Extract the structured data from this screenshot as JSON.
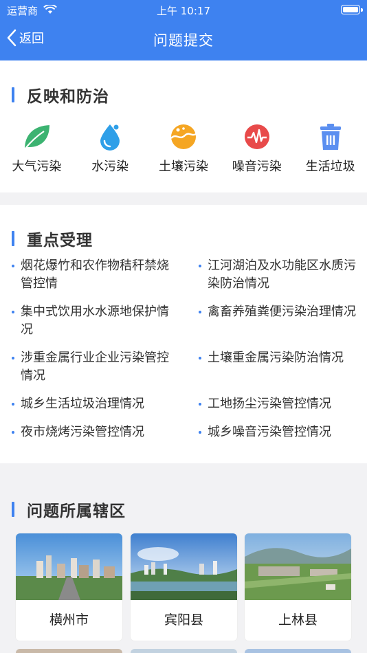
{
  "status_bar": {
    "carrier": "运营商",
    "time": "上午 10:17"
  },
  "nav": {
    "back_label": "返回",
    "title": "问题提交"
  },
  "section_prevention": {
    "title": "反映和防治",
    "items": [
      {
        "label": "大气污染",
        "icon": "leaf-icon",
        "color": "#3cb371"
      },
      {
        "label": "水污染",
        "icon": "water-drop-icon",
        "color": "#2f9fe8"
      },
      {
        "label": "土壤污染",
        "icon": "soil-icon",
        "color": "#f5a623"
      },
      {
        "label": "噪音污染",
        "icon": "sound-wave-icon",
        "color": "#e84a4a"
      },
      {
        "label": "生活垃圾",
        "icon": "trash-icon",
        "color": "#5b8ff0"
      }
    ]
  },
  "section_focus": {
    "title": "重点受理",
    "items": [
      {
        "text": "烟花爆竹和农作物秸秆禁烧管控情"
      },
      {
        "text": "江河湖泊及水功能区水质污染防治情况"
      },
      {
        "text": "集中式饮用水水源地保护情况"
      },
      {
        "text": "禽畜养殖粪便污染治理情况"
      },
      {
        "text": "涉重金属行业企业污染管控情况"
      },
      {
        "text": "土壤重金属污染防治情况"
      },
      {
        "text": "城乡生活垃圾治理情况"
      },
      {
        "text": "工地扬尘污染管控情况"
      },
      {
        "text": "夜市烧烤污染管控情况"
      },
      {
        "text": "城乡噪音污染管控情况"
      }
    ]
  },
  "section_district": {
    "title": "问题所属辖区",
    "items": [
      {
        "name": "横州市"
      },
      {
        "name": "宾阳县"
      },
      {
        "name": "上林县"
      }
    ]
  },
  "colors": {
    "accent": "#3e82f0",
    "background": "#f2f2f4"
  }
}
